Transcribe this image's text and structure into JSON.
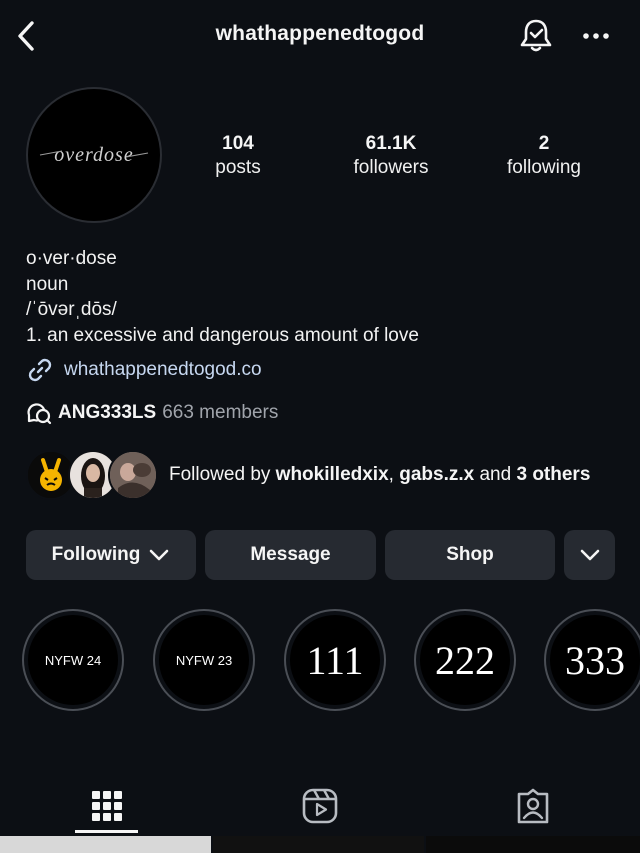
{
  "header": {
    "username": "whathappenedtogod",
    "icons": {
      "back": "chevron-left-icon",
      "bell": "notification-bell-icon",
      "more": "more-horizontal-icon"
    }
  },
  "profile": {
    "avatar_text": "overdose",
    "stats": {
      "posts": {
        "value": "104",
        "label": "posts"
      },
      "followers": {
        "value": "61.1K",
        "label": "followers"
      },
      "following": {
        "value": "2",
        "label": "following"
      }
    },
    "bio": [
      "o·ver·dose",
      "noun",
      "/ˈōvərˌdōs/",
      "1. an excessive and dangerous amount of love"
    ],
    "link": {
      "text": "whathappenedtogod.co",
      "icon": "link-icon"
    },
    "channel": {
      "name": "ANG333LS",
      "members": "663 members",
      "icon": "broadcast-channel-icon"
    },
    "followed_by": {
      "prefix": "Followed by",
      "user1": "whokilledxix",
      "separator": ",",
      "user2": "gabs.z.x",
      "conjunction": "and",
      "others": "3 others"
    }
  },
  "actions": {
    "following": "Following",
    "message": "Message",
    "shop": "Shop"
  },
  "highlights": [
    {
      "label": "NYFW 24"
    },
    {
      "label": "NYFW 23"
    },
    {
      "label": "111"
    },
    {
      "label": "222"
    },
    {
      "label": "333"
    }
  ],
  "tabs": [
    {
      "name": "posts-grid",
      "icon": "grid-icon"
    },
    {
      "name": "reels",
      "icon": "reels-icon"
    },
    {
      "name": "tagged",
      "icon": "tagged-person-icon"
    }
  ],
  "colors": {
    "background": "#0c0f14",
    "button": "#262a31",
    "link": "#c6d7f0",
    "muted": "#a0a4ab"
  }
}
